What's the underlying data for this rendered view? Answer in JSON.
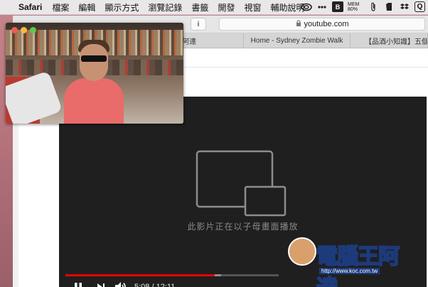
{
  "menubar": {
    "app_name": "Safari",
    "items": [
      "檔案",
      "編輯",
      "顯示方式",
      "瀏覽記錄",
      "書籤",
      "開發",
      "視窗",
      "輔助說明"
    ],
    "status": {
      "mem_label": "MEM",
      "mem_value": "80%",
      "b_badge": "B",
      "q_badge": "Q"
    }
  },
  "toolbar": {
    "url": "youtube.com",
    "reader_icon_label": "i"
  },
  "tabs": [
    {
      "label": "阿達"
    },
    {
      "label": "Home - Sydney Zombie Walk"
    },
    {
      "label": "【品酒小知識】五個品酒"
    }
  ],
  "player": {
    "pip_message": "此影片正在以子母畫面播放",
    "current_time": "5:08",
    "duration": "12:11",
    "time_display": "5:08 / 12:11",
    "progress_played_fraction": 0.7,
    "progress_loaded_fraction": 0.73
  },
  "watermark": {
    "text": "電腦王阿達",
    "url": "http://www.koc.com.tw"
  },
  "colors": {
    "progress_played": "#ee0000",
    "player_bg": "#1f1f1f",
    "desktop": "#c7868c"
  }
}
